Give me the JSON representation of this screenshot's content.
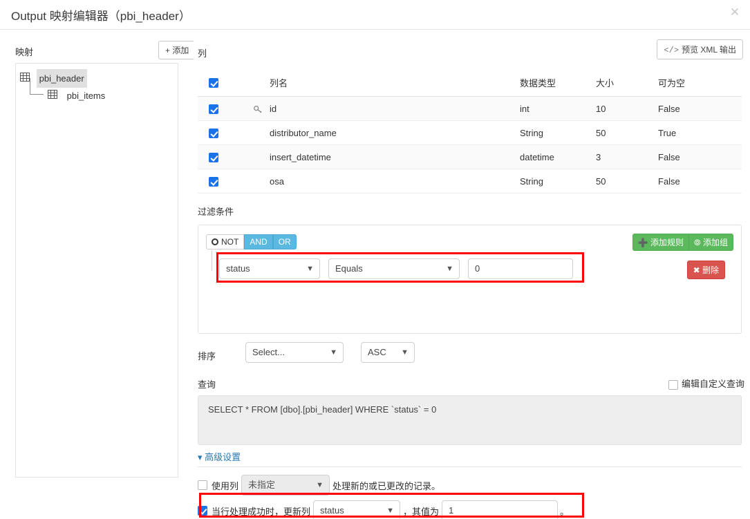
{
  "window": {
    "title": "Output 映射编辑器（pbi_header）",
    "close_icon": "close-icon"
  },
  "sidebar": {
    "label": "映射",
    "add_button": "+ 添加",
    "tree": [
      {
        "label": "pbi_header",
        "selected": true,
        "icon": "table-grid-icon"
      },
      {
        "label": "pbi_items",
        "selected": false,
        "icon": "table-grid-icon"
      }
    ]
  },
  "columns_section": {
    "label": "列",
    "preview_xml_button": "预览 XML 输出",
    "preview_xml_icon": "code-icon",
    "headers": {
      "name": "列名",
      "datatype": "数据类型",
      "size": "大小",
      "nullable": "可为空"
    },
    "select_all_checked": true,
    "rows": [
      {
        "checked": true,
        "key": true,
        "name": "id",
        "datatype": "int",
        "size": "10",
        "nullable": "False"
      },
      {
        "checked": true,
        "key": false,
        "name": "distributor_name",
        "datatype": "String",
        "size": "50",
        "nullable": "True"
      },
      {
        "checked": true,
        "key": false,
        "name": "insert_datetime",
        "datatype": "datetime",
        "size": "3",
        "nullable": "False"
      },
      {
        "checked": true,
        "key": false,
        "name": "osa",
        "datatype": "String",
        "size": "50",
        "nullable": "False"
      }
    ]
  },
  "filter_section": {
    "label": "过滤条件",
    "group": {
      "not_label": "NOT",
      "not_active": false,
      "and_label": "AND",
      "and_active": true,
      "or_label": "OR",
      "or_active": true,
      "add_rule_button": "添加规则",
      "add_rule_icon": "plus-icon",
      "add_group_button": "添加组",
      "add_group_icon": "plus-circle-icon"
    },
    "rule": {
      "field": "status",
      "operator": "Equals",
      "value": "0",
      "delete_button": "删除",
      "delete_icon": "times-icon"
    }
  },
  "sort_section": {
    "label": "排序",
    "column": "Select...",
    "direction": "ASC"
  },
  "query_section": {
    "label": "查询",
    "custom_checkbox_label": "编辑自定义查询",
    "custom_checked": false,
    "sql": "SELECT * FROM [dbo].[pbi_header] WHERE `status` = 0"
  },
  "advanced_section": {
    "toggle_label": "高级设置",
    "toggle_icon": "chevron-down-icon",
    "use_column_checked": false,
    "use_column_prefix": "使用列",
    "use_column_value": "未指定",
    "use_column_suffix": "处理新的或已更改的记录。",
    "update_row_checked": true,
    "update_row_prefix": "当行处理成功时，更新列",
    "update_row_column": "status",
    "update_row_middle": "，其值为",
    "update_row_value": "1",
    "update_row_suffix": "。"
  },
  "colors": {
    "accent_blue": "#1a73e8",
    "toggle_blue": "#5bb8e0",
    "green": "#5cb85c",
    "red": "#d9534f",
    "highlight": "#ff0000",
    "link": "#2a7ab0"
  }
}
